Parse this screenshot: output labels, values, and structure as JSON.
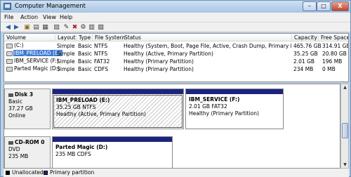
{
  "window": {
    "title": "Computer Management"
  },
  "menu": [
    "File",
    "Action",
    "View",
    "Help"
  ],
  "toolbar_icons": [
    "back-icon",
    "forward-icon",
    "up-icon",
    "properties-icon",
    "help-icon",
    "refresh-icon",
    "export-icon",
    "delete-icon",
    "settings-icon",
    "tasks-icon",
    "properties-sheet-icon"
  ],
  "volume_list": {
    "columns": [
      "Volume",
      "Layout",
      "Type",
      "File System",
      "Status",
      "Capacity",
      "Free Space"
    ],
    "rows": [
      [
        "(C:)",
        "Simple",
        "Basic",
        "NTFS",
        "Healthy (System, Boot, Page File, Active, Crash Dump, Primary Partition)",
        "465.76 GB",
        "314.91 GB"
      ],
      [
        "IBM_PRELOAD (E:)",
        "Simple",
        "Basic",
        "NTFS",
        "Healthy (Active, Primary Partition)",
        "35.25 GB",
        "20.80 GB"
      ],
      [
        "IBM_SERVICE (F:)",
        "Simple",
        "Basic",
        "FAT32",
        "Healthy (Primary Partition)",
        "2.01 GB",
        "196 MB"
      ],
      [
        "Parted Magic (D:)",
        "Simple",
        "Basic",
        "CDFS",
        "Healthy (Primary Partition)",
        "234 MB",
        "0 MB"
      ]
    ],
    "selected_row": 1
  },
  "disks": [
    {
      "name": "Disk 3",
      "kind": "Basic",
      "size": "37.27 GB",
      "status": "Online",
      "partitions": [
        {
          "name": "IBM_PRELOAD  (E:)",
          "size_fs": "35.25 GB NTFS",
          "status": "Healthy (Active, Primary Partition)"
        },
        {
          "name": "IBM_SERVICE  (F:)",
          "size_fs": "2.01 GB FAT32",
          "status": "Healthy (Primary Partition)"
        }
      ]
    },
    {
      "name": "CD-ROM 0",
      "kind": "DVD",
      "size": "235 MB",
      "partitions": [
        {
          "name": "Parted Magic  (D:)",
          "size_fs": "235 MB CDFS"
        }
      ]
    }
  ],
  "legend": [
    {
      "label": "Unallocated",
      "color": "#000000"
    },
    {
      "label": "Primary partition",
      "color": "#1c237f"
    }
  ],
  "colors": {
    "partition_bar": "#1c237f",
    "selection": "#3d7bd1"
  },
  "title_buttons": {
    "minimize": "–",
    "maximize": "□",
    "close": "X"
  }
}
